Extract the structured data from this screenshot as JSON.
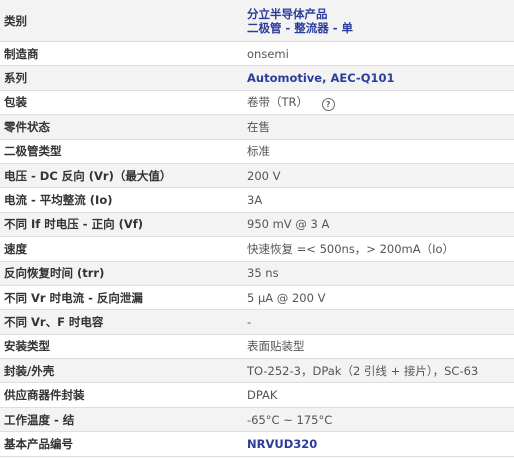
{
  "rows": [
    {
      "label": "类别",
      "value_lines": [
        "分立半导体产品",
        "二极管 - 整流器 - 单"
      ],
      "link": true
    },
    {
      "label": "制造商",
      "value": "onsemi"
    },
    {
      "label": "系列",
      "value": "Automotive, AEC-Q101",
      "link": true
    },
    {
      "label": "包装",
      "value": "卷带（TR）",
      "help": "?"
    },
    {
      "label": "零件状态",
      "value": "在售"
    },
    {
      "label": "二极管类型",
      "value": "标准"
    },
    {
      "label": "电压 - DC 反向 (Vr)（最大值）",
      "value": "200 V"
    },
    {
      "label": "电流 - 平均整流 (Io)",
      "value": "3A"
    },
    {
      "label": "不同 If 时电压 - 正向 (Vf)",
      "value": "950 mV @ 3 A"
    },
    {
      "label": "速度",
      "value": "快速恢复 =< 500ns，> 200mA（Io）"
    },
    {
      "label": "反向恢复时间 (trr)",
      "value": "35 ns"
    },
    {
      "label": "不同 Vr 时电流 - 反向泄漏",
      "value": "5 µA @ 200 V"
    },
    {
      "label": "不同 Vr、F 时电容",
      "value": "-"
    },
    {
      "label": "安装类型",
      "value": "表面贴装型"
    },
    {
      "label": "封装/外壳",
      "value": "TO-252-3，DPak（2 引线 + 接片），SC-63"
    },
    {
      "label": "供应商器件封装",
      "value": "DPAK"
    },
    {
      "label": "工作温度 - 结",
      "value": "-65°C ~ 175°C"
    },
    {
      "label": "基本产品编号",
      "value": "NRVUD320",
      "link": true
    }
  ]
}
